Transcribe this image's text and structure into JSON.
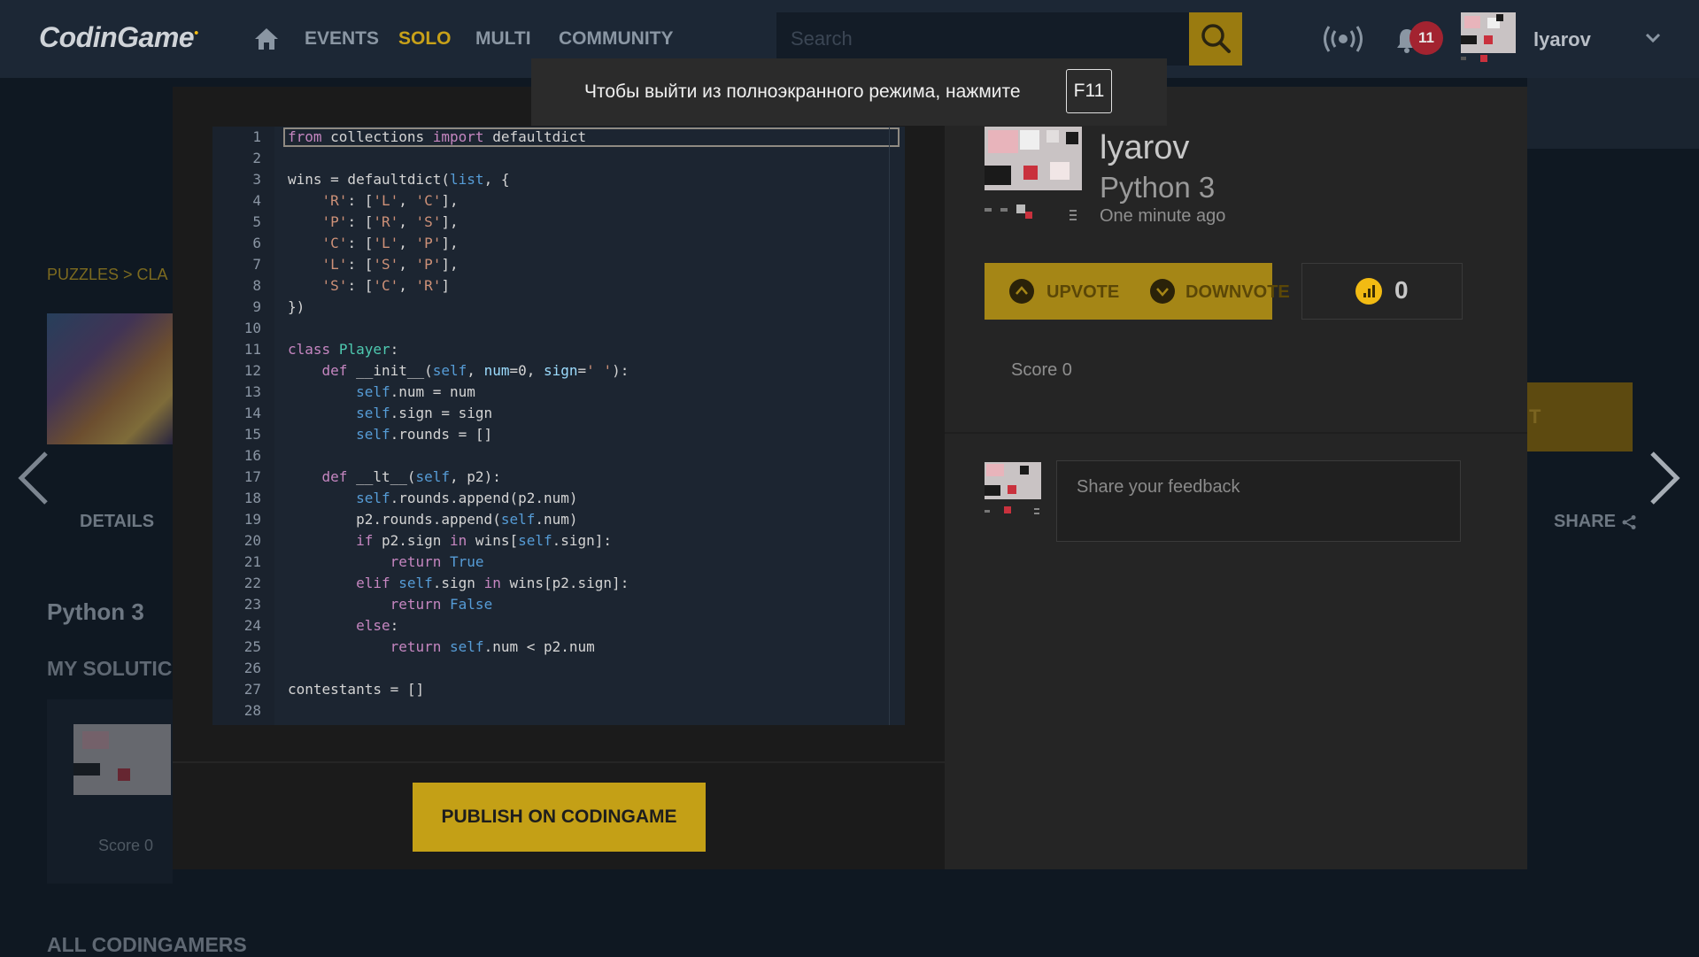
{
  "topbar": {
    "logo": "CodinGame",
    "nav": [
      "EVENTS",
      "SOLO",
      "MULTI",
      "COMMUNITY"
    ],
    "active_nav": "SOLO",
    "search_placeholder": "Search",
    "notifications_count": "11",
    "username": "lyarov"
  },
  "background_page": {
    "breadcrumb": "PUZZLES > CLA",
    "tab_details": "DETAILS",
    "share": "SHARE",
    "language": "Python 3",
    "my_solutions": "MY SOLUTIC",
    "card_score": "Score 0",
    "all_codingamers": "ALL CODINGAMERS",
    "orange_button_text": "T"
  },
  "fullscreen_toast": {
    "text": "Чтобы выйти из полноэкранного режима, нажмите",
    "key": "F11"
  },
  "editor": {
    "lines": [
      "from collections import defaultdict",
      "",
      "wins = defaultdict(list, {",
      "    'R': ['L', 'C'],",
      "    'P': ['R', 'S'],",
      "    'C': ['L', 'P'],",
      "    'L': ['S', 'P'],",
      "    'S': ['C', 'R']",
      "})",
      "",
      "class Player:",
      "    def __init__(self, num=0, sign=' '):",
      "        self.num = num",
      "        self.sign = sign",
      "        self.rounds = []",
      "",
      "    def __lt__(self, p2):",
      "        self.rounds.append(p2.num)",
      "        p2.rounds.append(self.num)",
      "        if p2.sign in wins[self.sign]:",
      "            return True",
      "        elif self.sign in wins[p2.sign]:",
      "            return False",
      "        else:",
      "            return self.num < p2.num",
      "",
      "contestants = []",
      ""
    ],
    "active_line": 1
  },
  "publish": {
    "label": "PUBLISH ON CODINGAME"
  },
  "solution": {
    "author": "lyarov",
    "language": "Python 3",
    "time": "One minute ago",
    "upvote": "UPVOTE",
    "downvote": "DOWNVOTE",
    "votes": "0",
    "score": "Score 0",
    "feedback_placeholder": "Share your feedback"
  },
  "colors": {
    "accent": "#f2bb13",
    "publish_button": "#c4a016",
    "vote_button": "#a58616",
    "notification_badge": "#a32330"
  },
  "icons": [
    "home-icon",
    "search-icon",
    "broadcast-icon",
    "bell-icon",
    "chevron-down-icon",
    "chevron-left-icon",
    "chevron-right-icon",
    "share-icon",
    "chevron-up-circle-icon",
    "chevron-down-circle-icon",
    "coin-icon"
  ]
}
